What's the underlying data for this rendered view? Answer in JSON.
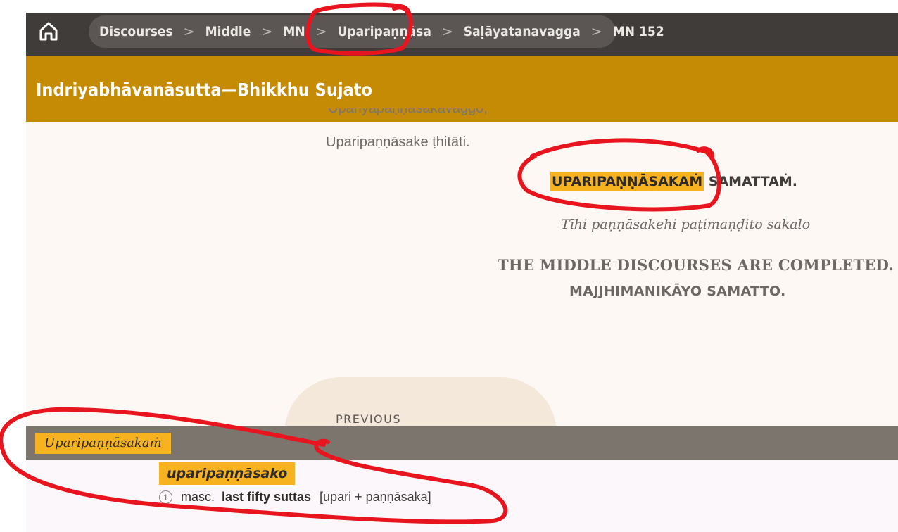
{
  "breadcrumb": {
    "items": [
      "Discourses",
      "Middle",
      "MN",
      "Uparipaṇṇāsa",
      "Saḷāyatanavagga",
      "MN 152"
    ],
    "separator": ">"
  },
  "header": {
    "title": "Indriyabhāvanāsutta—Bhikkhu Sujato"
  },
  "content": {
    "clipped_line": "Upariyapaṇṇāsakavaggo,",
    "thitati": "Uparipaṇṇāsake ṭhitāti.",
    "pali_heading_highlight": "UPARIPAṆṆĀSAKAṀ",
    "pali_heading_rest": " SAMATTAṀ.",
    "tihi": "Tīhi paṇṇāsakehi paṭimaṇḍito sakalo",
    "middle_completed": "THE MIDDLE DISCOURSES ARE COMPLETED.",
    "majjhima": "MAJJHIMANIKĀYO SAMATTO."
  },
  "navigation": {
    "previous_label": "PREVIOUS"
  },
  "lookup": {
    "term": "Uparipaṇṇāsakaṁ",
    "entry_word": "uparipaṇṇāsako",
    "sense_number": "1",
    "grammar": "masc.",
    "meaning": "last fifty suttas",
    "etymology": "[upari + paṇṇāsaka]"
  },
  "colors": {
    "topbar": "#403c3a",
    "crumb_pill": "#5b5654",
    "title_bar": "#c58b04",
    "highlight": "#f7b21f",
    "lookup_header": "#7c756e",
    "annotation": "#e8141e"
  },
  "icons": {
    "home": "home-icon"
  }
}
